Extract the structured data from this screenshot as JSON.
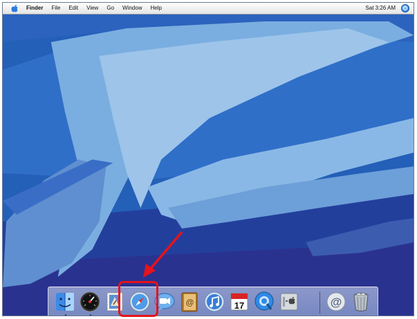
{
  "menubar": {
    "apple_icon": "apple-icon",
    "items": [
      {
        "label": "Finder",
        "bold": true
      },
      {
        "label": "File"
      },
      {
        "label": "Edit"
      },
      {
        "label": "View"
      },
      {
        "label": "Go"
      },
      {
        "label": "Window"
      },
      {
        "label": "Help"
      }
    ],
    "clock": "Sat 3:26 AM",
    "spotlight_icon": "spotlight-icon"
  },
  "dock": {
    "items": [
      {
        "icon": "finder-icon",
        "running": true
      },
      {
        "icon": "dashboard-icon",
        "running": true
      },
      {
        "icon": "mail-icon",
        "running": false
      },
      {
        "icon": "safari-icon",
        "running": false
      },
      {
        "icon": "ichat-icon",
        "running": false
      },
      {
        "icon": "address-book-icon",
        "running": false
      },
      {
        "icon": "itunes-icon",
        "running": false
      },
      {
        "icon": "ical-icon",
        "running": false,
        "date": "17"
      },
      {
        "icon": "quicktime-icon",
        "running": false
      },
      {
        "icon": "system-preferences-icon",
        "running": false
      },
      {
        "icon": "mail-stack-icon",
        "running": false
      },
      {
        "icon": "trash-icon",
        "running": false
      }
    ]
  },
  "annotation": {
    "color": "#e8121a",
    "target": "safari-icon"
  },
  "colors": {
    "wallpaper_dark": "#1c3f98",
    "wallpaper_mid": "#2e6cc4",
    "wallpaper_light": "#7aaee0",
    "wallpaper_pale": "#9ec4ea"
  }
}
